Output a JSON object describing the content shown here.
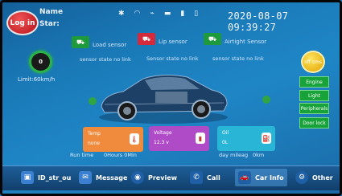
{
  "header": {
    "login_label": "Log in",
    "name_label": "Name",
    "star_label": "Star:",
    "datetime": "2020-08-07 09:39:27",
    "status_icons": [
      "bluetooth-icon",
      "wifi-icon",
      "usb-icon",
      "car-icon",
      "signal-icon",
      "battery-icon"
    ]
  },
  "sensors": {
    "load_sensor": "Load sensor",
    "lip_sensor": "Lip sensor",
    "airtight_sensor": "Airtight Sensor",
    "load_state": "sensor state no link",
    "lip_state": "Sensor state no link",
    "airtight_state": "sensor state no link"
  },
  "gauge": {
    "value": "0",
    "limit": "Limit:60km/h"
  },
  "right_panel": {
    "off_button": "off cms",
    "buttons": [
      "Engine",
      "Light",
      "Peripherals",
      "Door lock"
    ]
  },
  "cards": {
    "temp_title": "Temp",
    "temp_value": "none",
    "voltage_title": "Voltage",
    "voltage_value": "12.3 v",
    "oil_title": "Oil",
    "oil_value": "0L"
  },
  "stats": {
    "run_time_label": "Run time",
    "run_time_value": "0Hours 0Min",
    "day_mileage_label": "day mileag",
    "day_mileage_value": "0km"
  },
  "nav": [
    {
      "label": "ID_str_ou"
    },
    {
      "label": "Message"
    },
    {
      "label": "Preview"
    },
    {
      "label": "Call"
    },
    {
      "label": "Car Info"
    },
    {
      "label": "Other"
    }
  ],
  "colors": {
    "background": "#1a7ab8",
    "login": "#d6232e",
    "active_green": "#18a23a",
    "temp_card": "#f08a3c",
    "voltage_card": "#b04bc8",
    "oil_card": "#29b5d6"
  }
}
